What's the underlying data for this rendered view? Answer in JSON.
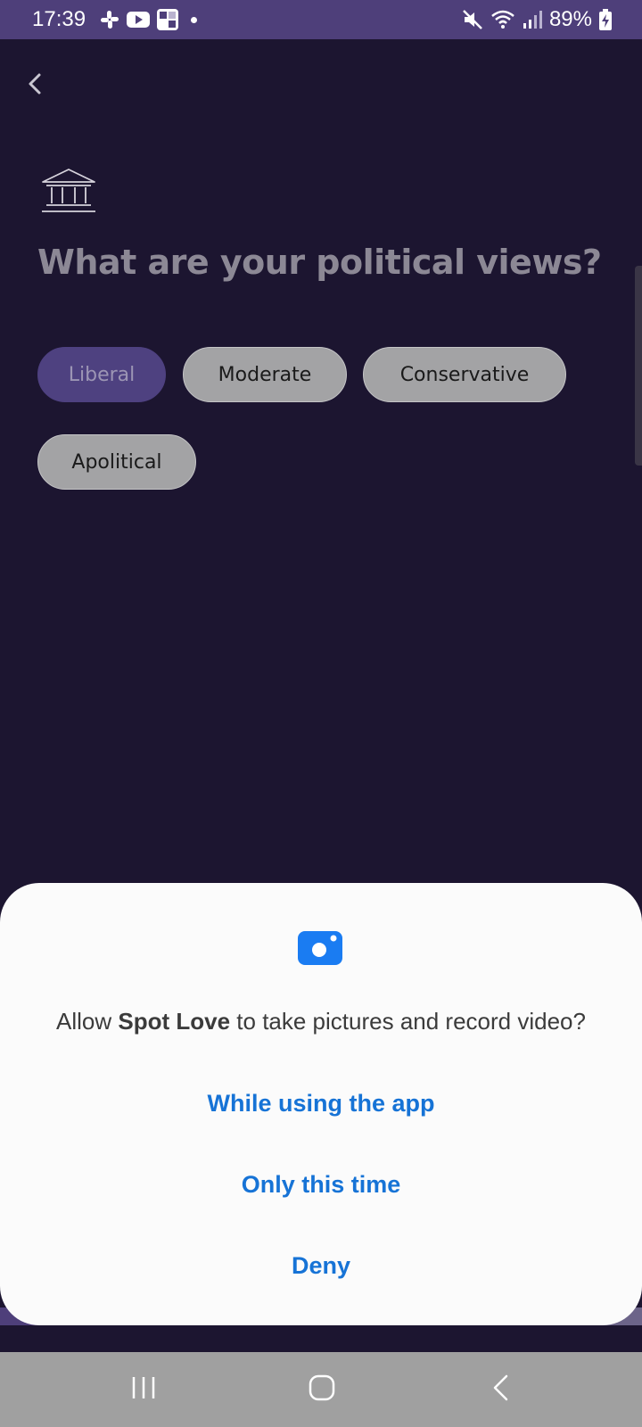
{
  "status_bar": {
    "time": "17:39",
    "battery": "89%",
    "left_icons": [
      "slack-icon",
      "youtube-icon",
      "grid-app-icon",
      "notification-dot-icon"
    ],
    "right_icons": [
      "mute-icon",
      "wifi-icon",
      "signal-icon",
      "battery-charging-icon"
    ]
  },
  "page": {
    "back_icon": "chevron-left-icon",
    "section_icon": "government-building-icon",
    "title": "What are your political views?"
  },
  "options": [
    {
      "label": "Liberal",
      "selected": true
    },
    {
      "label": "Moderate",
      "selected": false
    },
    {
      "label": "Conservative",
      "selected": false
    },
    {
      "label": "Apolitical",
      "selected": false
    }
  ],
  "dialog": {
    "icon": "camera-icon",
    "text_prefix": "Allow ",
    "app_name": "Spot Love",
    "text_suffix": " to take pictures and record video?",
    "buttons": {
      "while_using": "While using the app",
      "only_this_time": "Only this time",
      "deny": "Deny"
    }
  },
  "colors": {
    "background": "#1c1530",
    "accent": "#4e3f7a",
    "link_blue": "#1673d6"
  },
  "nav_bar": {
    "icons": [
      "recent-apps-icon",
      "home-icon",
      "back-icon"
    ]
  }
}
